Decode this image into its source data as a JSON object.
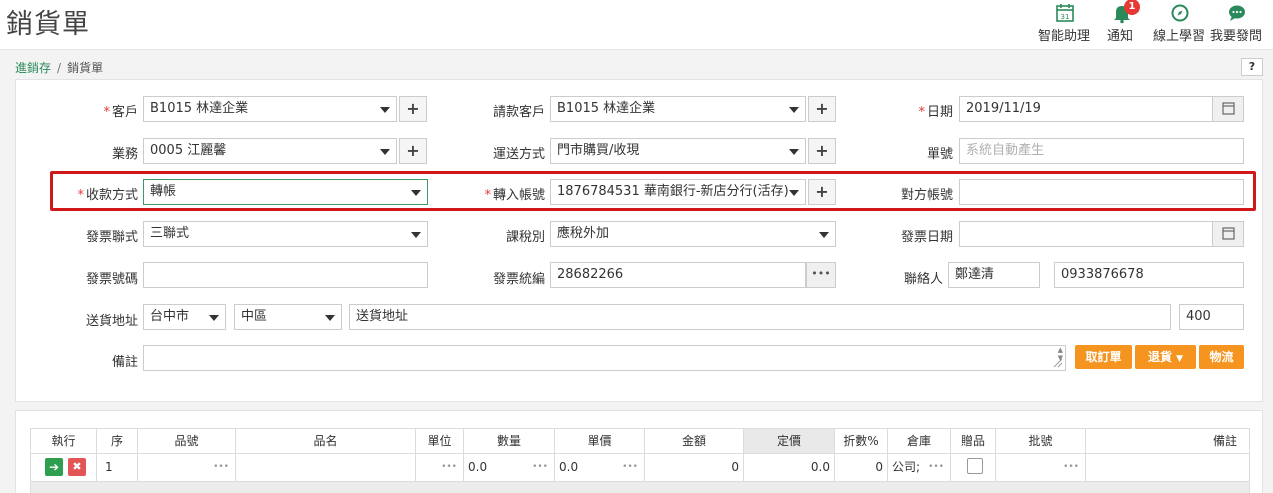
{
  "header": {
    "title": "銷貨單",
    "buttons": [
      {
        "label": "智能助理",
        "icon": "calendar-31-icon",
        "day": "31"
      },
      {
        "label": "通知",
        "icon": "bell-icon",
        "badge": "1"
      },
      {
        "label": "線上學習",
        "icon": "compass-icon"
      },
      {
        "label": "我要發問",
        "icon": "chat-bubble-icon"
      }
    ]
  },
  "breadcrumb": {
    "parent": "進銷存",
    "separator": "/",
    "current": "銷貨單"
  },
  "help_label": "?",
  "form": {
    "customer": {
      "label": "客戶",
      "value": "B1015 林達企業"
    },
    "billing_customer": {
      "label": "請款客戶",
      "value": "B1015 林達企業"
    },
    "date": {
      "label": "日期",
      "value": "2019/11/19"
    },
    "salesperson": {
      "label": "業務",
      "value": "0005 江麗馨"
    },
    "delivery_method": {
      "label": "運送方式",
      "value": "門市購買/收現"
    },
    "doc_no": {
      "label": "單號",
      "placeholder": "系統自動產生"
    },
    "payment_method": {
      "label": "收款方式",
      "value": "轉帳"
    },
    "deposit_account": {
      "label": "轉入帳號",
      "value": "1876784531 華南銀行-新店分行(活存)"
    },
    "counter_account": {
      "label": "對方帳號",
      "value": ""
    },
    "invoice_type": {
      "label": "發票聯式",
      "value": "三聯式"
    },
    "tax_type": {
      "label": "課稅別",
      "value": "應稅外加"
    },
    "invoice_date": {
      "label": "發票日期",
      "value": ""
    },
    "invoice_no": {
      "label": "發票號碼",
      "value": ""
    },
    "tax_id": {
      "label": "發票統編",
      "value": "28682266"
    },
    "contact": {
      "label": "聯絡人",
      "name": "鄭達清",
      "phone": "0933876678"
    },
    "address": {
      "label": "送貨地址",
      "city": "台中市",
      "district": "中區",
      "street": "送貨地址",
      "zip": "400"
    },
    "remarks": {
      "label": "備註",
      "value": ""
    },
    "actions": {
      "cancel_order": "取訂單",
      "return": "退貨",
      "logistics": "物流"
    }
  },
  "grid": {
    "columns": [
      "執行",
      "序",
      "品號",
      "品名",
      "單位",
      "數量",
      "單價",
      "金額",
      "定價",
      "折數%",
      "倉庫",
      "贈品",
      "批號",
      "備註"
    ],
    "rows": [
      {
        "seq": "1",
        "qty": "0.0",
        "price": "0.0",
        "amount": "0",
        "list_price": "0.0",
        "discount": "0",
        "warehouse": "公司;"
      }
    ]
  },
  "ellipsis": "•••",
  "colors": {
    "accent_green": "#2a8a5a",
    "required_red": "#e53935",
    "highlight_red": "#d0181b",
    "action_orange": "#f5941f"
  }
}
